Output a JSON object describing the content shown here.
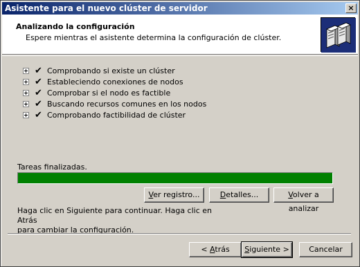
{
  "window": {
    "title": "Asistente para el nuevo clúster de servidor",
    "close_glyph": "×"
  },
  "header": {
    "title": "Analizando la configuración",
    "subtitle": "Espere mientras el asistente determina la configuración de clúster.",
    "icon": "server-cluster-icon"
  },
  "steps": [
    {
      "label": "Comprobando si existe un clúster",
      "status": "done"
    },
    {
      "label": "Estableciendo conexiones de nodos",
      "status": "done"
    },
    {
      "label": "Comprobar si el nodo es factible",
      "status": "done"
    },
    {
      "label": "Buscando recursos comunes en los nodos",
      "status": "done"
    },
    {
      "label": "Comprobando factibilidad de clúster",
      "status": "done"
    }
  ],
  "status": {
    "label": "Tareas finalizadas.",
    "progress_percent": 100,
    "progress_color": "#008000"
  },
  "actions": {
    "view_log": {
      "accel": "V",
      "rest": "er registro..."
    },
    "details": {
      "accel": "D",
      "rest": "etalles..."
    },
    "reanalyze": {
      "accel": "V",
      "rest": "olver a analizar"
    }
  },
  "info": {
    "line1": "Haga clic en Siguiente para continuar. Haga clic en Atrás",
    "line2": "para cambiar la configuración."
  },
  "nav": {
    "back_prefix": "< ",
    "back_accel": "A",
    "back_rest": "trás",
    "next_accel": "S",
    "next_rest": "iguiente >",
    "cancel": "Cancelar"
  },
  "check_glyph": "✔"
}
